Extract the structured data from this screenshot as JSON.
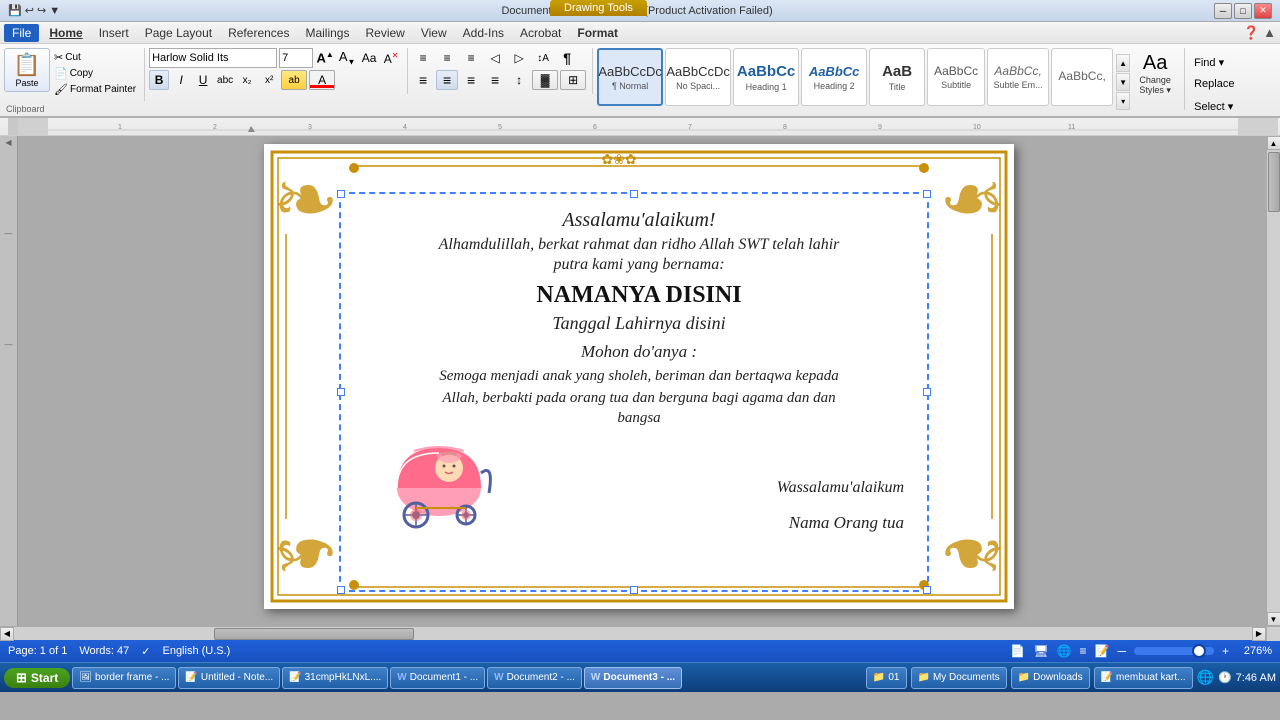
{
  "titlebar": {
    "title": "Document3 - Microsoft Word (Product Activation Failed)",
    "drawing_tools": "Drawing Tools",
    "minimize": "─",
    "maximize": "□",
    "close": "✕"
  },
  "quickaccess": {
    "save": "💾",
    "undo": "↩",
    "redo": "↪",
    "more": "▼"
  },
  "menu": {
    "file": "File",
    "home": "Home",
    "insert": "Insert",
    "pagelayout": "Page Layout",
    "references": "References",
    "mailings": "Mailings",
    "review": "Review",
    "view": "View",
    "addins": "Add-Ins",
    "acrobat": "Acrobat",
    "format": "Format"
  },
  "ribbon": {
    "clipboard": {
      "paste": "Paste",
      "cut": "Cut",
      "copy": "Copy",
      "formatpainter": "Format Painter"
    },
    "font": {
      "name": "Harlow Solid Its",
      "size": "7",
      "bold": "B",
      "italic": "I",
      "underline": "U",
      "strikethrough": "abc",
      "subscript": "x₂",
      "superscript": "x²",
      "grow": "A▲",
      "shrink": "A▼",
      "change_case": "Aa",
      "clear": "A",
      "highlight": "ab",
      "color": "A"
    },
    "paragraph": {
      "bullets": "≡•",
      "numbering": "≡1",
      "multilevel": "≡¶",
      "indent_left": "◁",
      "indent_right": "▷",
      "sort": "↕A",
      "showhide": "¶",
      "align_left": "≡",
      "align_center": "≡",
      "align_right": "≡",
      "justify": "≡",
      "linespacing": "↕",
      "shading": "▓",
      "borders": "⊞"
    },
    "styles": {
      "normal_label": "¶ Normal",
      "nospacing_label": "No Spaci...",
      "heading1_label": "Heading 1",
      "heading2_label": "Heading 2",
      "title_label": "Title",
      "subtitle_label": "Subtitle",
      "subtleemphasis_label": "Subtle Em...",
      "aabbcc_label": "AaBbCcDc"
    },
    "editing": {
      "find": "Find ▾",
      "replace": "Replace",
      "select": "Select ▾"
    }
  },
  "document": {
    "line1": "Assalamu'alaikum!",
    "line2": "Alhamdulillah, berkat rahmat dan ridho Allah SWT telah lahir",
    "line3": "putra kami yang bernama:",
    "line4": "NAMANYA DISINI",
    "line5": "Tanggal Lahirnya disini",
    "line6": "Mohon do'anya :",
    "line7": "Semoga menjadi anak yang sholeh, beriman dan bertaqwa kepada",
    "line8": "Allah, berbakti pada orang tua dan berguna bagi agama dan dan",
    "line9": "bangsa",
    "line10": "Wassalamu'alaikum",
    "line11": "Nama Orang tua"
  },
  "statusbar": {
    "page": "Page: 1 of 1",
    "words": "Words: 47",
    "language": "English (U.S.)",
    "zoom": "276%"
  },
  "taskbar": {
    "start": "Start",
    "items": [
      {
        "icon": "🖼",
        "label": "border frame - ..."
      },
      {
        "icon": "📝",
        "label": "Untitled - Note..."
      },
      {
        "icon": "📝",
        "label": "31cmpHkLNxL...."
      },
      {
        "icon": "W",
        "label": "Document1 - ..."
      },
      {
        "icon": "W",
        "label": "Document2 - ..."
      },
      {
        "icon": "W",
        "label": "Document3 - ...",
        "active": true
      }
    ],
    "systray": {
      "folder": "01",
      "mydocs": "My Documents",
      "downloads": "Downloads",
      "mebuat": "membuat kart...",
      "ie": "🌐",
      "time": "7:46 AM"
    }
  }
}
